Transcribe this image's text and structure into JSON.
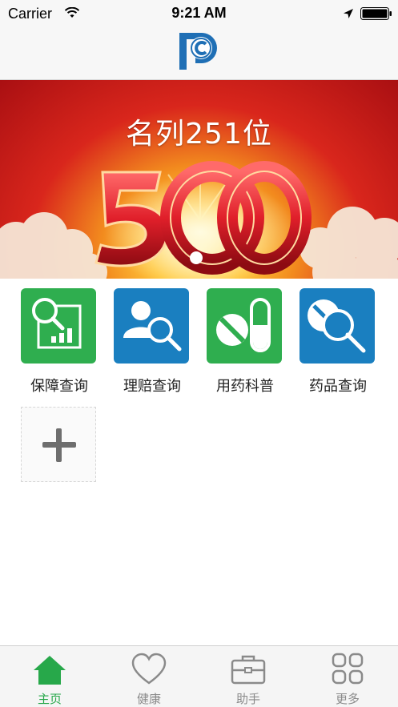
{
  "status_bar": {
    "carrier": "Carrier",
    "time": "9:21 AM"
  },
  "header": {
    "logo_icon": "pc-logo-icon"
  },
  "banner": {
    "title": "名列251位",
    "number": "500"
  },
  "menu": {
    "items": [
      {
        "label": "保障查询",
        "icon": "document-search-icon",
        "color": "#2fae4f"
      },
      {
        "label": "理赔查询",
        "icon": "user-search-icon",
        "color": "#1a7fc0"
      },
      {
        "label": "用药科普",
        "icon": "pills-icon",
        "color": "#2fae4f"
      },
      {
        "label": "药品查询",
        "icon": "medicine-search-icon",
        "color": "#1a7fc0"
      }
    ],
    "add_icon": "plus-icon"
  },
  "tab_bar": {
    "tabs": [
      {
        "label": "主页",
        "icon": "home-icon",
        "active": true
      },
      {
        "label": "健康",
        "icon": "heart-icon",
        "active": false
      },
      {
        "label": "助手",
        "icon": "briefcase-icon",
        "active": false
      },
      {
        "label": "更多",
        "icon": "grid-icon",
        "active": false
      }
    ],
    "active_color": "#27a84a",
    "inactive_color": "#8a8a8a"
  }
}
